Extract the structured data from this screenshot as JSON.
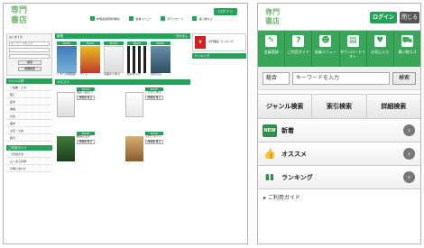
{
  "logo": {
    "line1": "専門",
    "line2": "書店"
  },
  "desktop": {
    "login_label": "ログイン",
    "topnav": [
      "新規会員登録(無料)",
      "会員メニュー",
      "ダウンロード",
      "買い物カゴ"
    ],
    "sidebar": {
      "search_title": "はじめての",
      "keyword_placeholder": "キーワードを入力",
      "search_button": "検索",
      "detail_button": "詳細検索",
      "genre_head": "ジャンル別",
      "genres": [
        "一般書・人文",
        "理工",
        "医学",
        "看護",
        "社会",
        "語学",
        "文芸・小説",
        "経済"
      ],
      "guide_head": "ご利用ガイド",
      "guide_items": [
        "ご利用方法",
        "よくある質問",
        "お問い合わせ"
      ]
    },
    "main": {
      "new_head": "新着",
      "more": "一覧を見る",
      "badge": "BOOK",
      "new_books": [
        "くすりの地図帳",
        "サバい",
        "基礎から学ぶ",
        "統計学入門",
        "世界の山"
      ],
      "rec_head": "オススメ",
      "rec_button": "詳細を見る",
      "rec_titles": [
        "臨床で役立つ",
        "これから学ぶ",
        "腰痛を治す",
        "入門テキスト"
      ]
    },
    "right": {
      "ad_text": "専門書店 ランキング",
      "ranking_head": "ランキング"
    }
  },
  "mobile": {
    "login_label": "ログイン",
    "close_label": "閉じる",
    "icons": [
      {
        "glyph": "✎",
        "label": "会員登録"
      },
      {
        "glyph": "?",
        "label": "ご利用ガイド"
      },
      {
        "glyph": "☻",
        "label": "会員メニュー"
      },
      {
        "glyph": "▤",
        "label": "ダウンロードリスト"
      },
      {
        "glyph": "♥",
        "label": "お気に入り"
      },
      {
        "glyph": "⛟",
        "label": "買い物カゴ"
      }
    ],
    "search": {
      "scope": "総合",
      "placeholder": "キーワードを入力",
      "button": "検索"
    },
    "tabs": [
      "ジャンル検索",
      "索引検索",
      "詳細検索"
    ],
    "rows": [
      {
        "icon": "NEW",
        "label": "新着"
      },
      {
        "icon": "👍",
        "label": "オススメ"
      },
      {
        "icon": "▮▮",
        "label": "ランキング"
      }
    ],
    "guide": "ご利用ガイド",
    "colors": {
      "accent": "#3aa659"
    }
  }
}
